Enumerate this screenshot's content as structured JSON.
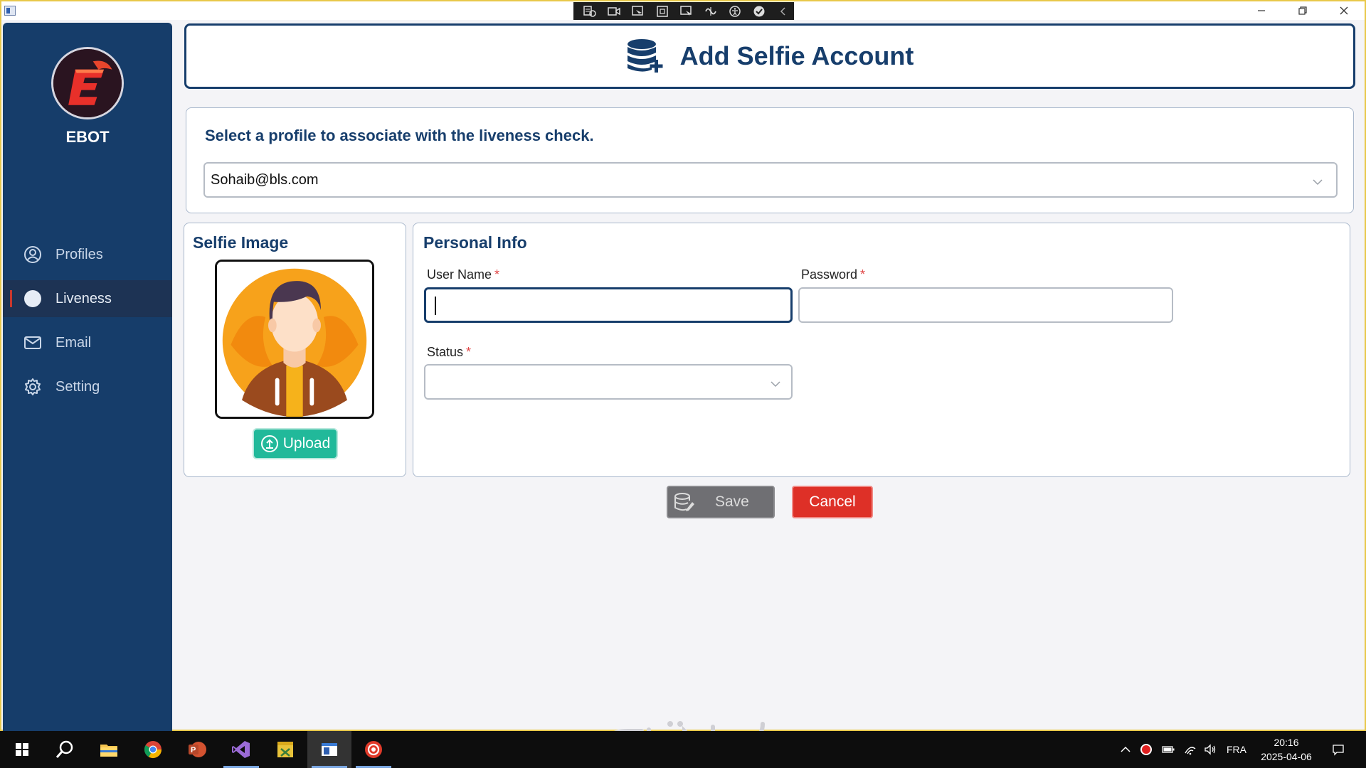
{
  "app": {
    "brand": "EBOT"
  },
  "sidebar": {
    "items": [
      {
        "label": "Profiles",
        "icon": "user-circle-icon",
        "active": false
      },
      {
        "label": "Liveness",
        "icon": "circle-icon",
        "active": true
      },
      {
        "label": "Email",
        "icon": "envelope-icon",
        "active": false
      },
      {
        "label": "Setting",
        "icon": "gear-icon",
        "active": false
      }
    ]
  },
  "header": {
    "title": "Add Selfie Account",
    "icon": "database-plus-icon"
  },
  "profile": {
    "question": "Select a profile to associate with the liveness check.",
    "selected": "Sohaib@bls.com"
  },
  "selfie": {
    "title": "Selfie Image",
    "upload_label": "Upload"
  },
  "personal": {
    "title": "Personal Info",
    "username_label": "User Name",
    "password_label": "Password",
    "status_label": "Status",
    "required_mark": "*",
    "username_value": "",
    "password_value": "",
    "status_value": ""
  },
  "actions": {
    "save_label": "Save",
    "cancel_label": "Cancel"
  },
  "tray": {
    "language": "FRA",
    "time": "20:16",
    "date": "2025-04-06"
  },
  "colors": {
    "sidebar": "#163d6a",
    "accent": "#173e6c",
    "upload": "#21b99a",
    "cancel": "#de3027",
    "save": "#6f6f73"
  }
}
